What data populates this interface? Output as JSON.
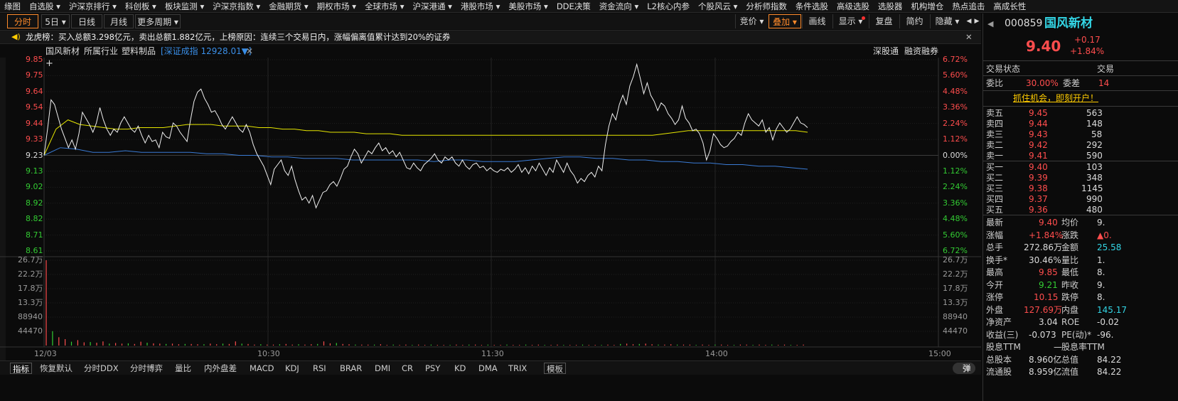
{
  "nav": {
    "items": [
      "缘图",
      "自选股 ▾",
      "沪深京排行 ▾",
      "科创板 ▾",
      "板块监测 ▾",
      "沪深京指数 ▾",
      "金融期货 ▾",
      "期权市场 ▾",
      "全球市场 ▾",
      "沪深港通 ▾",
      "港股市场 ▾",
      "美股市场 ▾",
      "DDE决策",
      "资金流向 ▾",
      "L2核心内参",
      "个股风云 ▾",
      "分析师指数",
      "条件选股",
      "高级选股",
      "选股器",
      "机构增仓",
      "热点追击",
      "高成长性"
    ]
  },
  "periods": {
    "intraday": "分时",
    "five_day": "5日 ▾",
    "daily": "日线",
    "monthly": "月线",
    "more": "更多周期 ▾"
  },
  "tools": {
    "bid": "竞价 ▾",
    "overlay": "叠加 ▾",
    "draw": "画线",
    "display": "显示 ▾",
    "replay": "复盘",
    "simple": "简约",
    "hide": "隐藏 ▾",
    "prev": "◀",
    "next": "▶",
    "close": "✕"
  },
  "banner": {
    "icon": "speaker-icon",
    "text": "龙虎榜：买入总额3.298亿元，卖出总额1.882亿元，上榜原因：连续三个交易日内，涨幅偏离值累计达到20%的证券",
    "close": "✕"
  },
  "chart_header": {
    "stock": "国风新材",
    "industry_label": "所属行业",
    "industry": "塑料制品",
    "index": "[深证成指 12928.01▼]",
    "index_close": "✕",
    "shgt": "深股通",
    "margin": "融资融券"
  },
  "chart_data": {
    "type": "line",
    "title": "",
    "price_axis": [
      "9.85",
      "9.75",
      "9.64",
      "9.54",
      "9.44",
      "9.33",
      "9.23",
      "9.13",
      "9.02",
      "8.92",
      "8.82",
      "8.71",
      "8.61"
    ],
    "pct_axis": [
      "6.72%",
      "5.60%",
      "4.48%",
      "3.36%",
      "2.24%",
      "1.12%",
      "0.00%",
      "1.12%",
      "2.24%",
      "3.36%",
      "4.48%",
      "5.60%",
      "6.72%"
    ],
    "pre_close": 9.23,
    "ylim": [
      8.61,
      9.85
    ],
    "volume_axis": [
      "26.7万",
      "22.2万",
      "17.8万",
      "13.3万",
      "88940",
      "44470"
    ],
    "time_labels": [
      "12/03",
      "10:30",
      "11:30",
      "14:00",
      "15:00"
    ],
    "series": [
      {
        "name": "price",
        "color": "#f0f0f0",
        "values": [
          9.23,
          9.4,
          9.59,
          9.56,
          9.48,
          9.4,
          9.34,
          9.28,
          9.33,
          9.27,
          9.37,
          9.51,
          9.47,
          9.43,
          9.38,
          9.44,
          9.54,
          9.46,
          9.4,
          9.36,
          9.4,
          9.38,
          9.44,
          9.48,
          9.44,
          9.4,
          9.38,
          9.42,
          9.36,
          9.31,
          9.36,
          9.32,
          9.33,
          9.28,
          9.38,
          9.35,
          9.34,
          9.44,
          9.42,
          9.38,
          9.35,
          9.32,
          9.46,
          9.58,
          9.64,
          9.66,
          9.6,
          9.56,
          9.51,
          9.52,
          9.48,
          9.43,
          9.4,
          9.44,
          9.48,
          9.44,
          9.4,
          9.38,
          9.43,
          9.38,
          9.3,
          9.24,
          9.2,
          9.16,
          9.1,
          9.04,
          9.14,
          9.17,
          9.2,
          9.13,
          9.1,
          9.16,
          9.07,
          9.0,
          8.94,
          8.96,
          8.92,
          8.97,
          8.89,
          8.94,
          8.99,
          9.0,
          9.04,
          9.06,
          9.03,
          9.08,
          9.14,
          9.16,
          9.22,
          9.27,
          9.24,
          9.18,
          9.22,
          9.26,
          9.24,
          9.28,
          9.31,
          9.26,
          9.28,
          9.24,
          9.26,
          9.22,
          9.25,
          9.2,
          9.15,
          9.14,
          9.18,
          9.15,
          9.13,
          9.17,
          9.19,
          9.21,
          9.24,
          9.2,
          9.18,
          9.22,
          9.2,
          9.22,
          9.18,
          9.16,
          9.2,
          9.16,
          9.14,
          9.17,
          9.18,
          9.15,
          9.16,
          9.13,
          9.15,
          9.13,
          9.12,
          9.14,
          9.13,
          9.15,
          9.12,
          9.14,
          9.17,
          9.12,
          9.15,
          9.11,
          9.16,
          9.13,
          9.18,
          9.14,
          9.1,
          9.15,
          9.12,
          9.2,
          9.16,
          9.12,
          9.18,
          9.13,
          9.1,
          9.05,
          9.08,
          9.06,
          9.1,
          9.12,
          9.09,
          9.16,
          9.13,
          9.3,
          9.42,
          9.5,
          9.46,
          9.56,
          9.62,
          9.56,
          9.68,
          9.74,
          9.82,
          9.73,
          9.63,
          9.7,
          9.62,
          9.58,
          9.52,
          9.57,
          9.55,
          9.5,
          9.47,
          9.43,
          9.46,
          9.55,
          9.47,
          9.44,
          9.39,
          9.4,
          9.37,
          9.31,
          9.2,
          9.26,
          9.37,
          9.34,
          9.3,
          9.28,
          9.29,
          9.32,
          9.34,
          9.38,
          9.36,
          9.44,
          9.5,
          9.46,
          9.44,
          9.42,
          9.46,
          9.38,
          9.41,
          9.33,
          9.4,
          9.44,
          9.41,
          9.38,
          9.4,
          9.44,
          9.48,
          9.44,
          9.43,
          9.41
        ]
      },
      {
        "name": "avg",
        "color": "#e6e600",
        "values": [
          9.23,
          9.4,
          9.46,
          9.43,
          9.42,
          9.41,
          9.4,
          9.4,
          9.41,
          9.41,
          9.41,
          9.42,
          9.43,
          9.43,
          9.43,
          9.42,
          9.42,
          9.42,
          9.41,
          9.41,
          9.4,
          9.4,
          9.39,
          9.39,
          9.38,
          9.38,
          9.38,
          9.37,
          9.37,
          9.37,
          9.36,
          9.36,
          9.36,
          9.36,
          9.36,
          9.36,
          9.36,
          9.36,
          9.36,
          9.36,
          9.36,
          9.36,
          9.36,
          9.36,
          9.36,
          9.36,
          9.36,
          9.36,
          9.36,
          9.36,
          9.36,
          9.36,
          9.37,
          9.38,
          9.39,
          9.39,
          9.39,
          9.39,
          9.39,
          9.39,
          9.39,
          9.39,
          9.39,
          9.39,
          9.38
        ]
      },
      {
        "name": "index",
        "color": "#3a7bd5",
        "values": [
          9.23,
          9.28,
          9.27,
          9.25,
          9.25,
          9.26,
          9.25,
          9.25,
          9.25,
          9.25,
          9.24,
          9.24,
          9.23,
          9.23,
          9.22,
          9.22,
          9.21,
          9.21,
          9.21,
          9.2,
          9.2,
          9.2,
          9.2,
          9.2,
          9.19,
          9.2,
          9.2,
          9.19,
          9.19,
          9.19,
          9.2,
          9.21,
          9.22,
          9.22,
          9.21,
          9.21,
          9.2,
          9.2,
          9.19,
          9.19,
          9.18,
          9.18,
          9.17,
          9.17,
          9.16,
          9.16,
          9.15,
          9.14
        ]
      }
    ],
    "volume": [
      26.7,
      4.5,
      2.6,
      2.0,
      1.2,
      1.7,
      1.0,
      1.1,
      0.9,
      1.3,
      0.6,
      0.8,
      0.6,
      0.7,
      0.5,
      1.2,
      0.9,
      0.7,
      0.6,
      0.5,
      0.6,
      0.4,
      0.5,
      0.5,
      0.4,
      0.4,
      0.6,
      0.4,
      0.6,
      0.5,
      1.3,
      0.6,
      0.5,
      0.3,
      0.4,
      0.3,
      0.3,
      0.4,
      0.5,
      0.3,
      0.4,
      0.3,
      0.4,
      0.5,
      1.3,
      0.7,
      0.8,
      0.5,
      0.4,
      0.3,
      0.3,
      0.3,
      0.3,
      0.4,
      0.2,
      0.3,
      0.2,
      0.3,
      0.2,
      0.3,
      0.2,
      0.3,
      0.2,
      0.2,
      0.2,
      0.3,
      0.2,
      0.3,
      0.3,
      0.2,
      0.3,
      0.2,
      0.2,
      0.3,
      0.2,
      0.2,
      0.3,
      0.2,
      0.3,
      0.2,
      0.2,
      0.3,
      0.2,
      0.2,
      0.2,
      0.3,
      0.2,
      0.2,
      0.2,
      0.3,
      0.2,
      0.5,
      0.6,
      0.4,
      0.5,
      0.6,
      0.4,
      0.3,
      0.3,
      0.4,
      0.3,
      0.3,
      0.3,
      0.2,
      0.3,
      0.2,
      0.3,
      0.3,
      0.2,
      0.2,
      0.3,
      0.3,
      0.2,
      0.3,
      0.2,
      0.3,
      0.2,
      0.3,
      0.2,
      0.2,
      0.3
    ]
  },
  "indicators": {
    "items": [
      "指标",
      "恢复默认",
      "分时DDX",
      "分时博弈",
      "量比",
      "内外盘差",
      "MACD",
      "KDJ",
      "RSI",
      "BRAR",
      "DMI",
      "CR",
      "PSY",
      "KD",
      "DMA",
      "TRIX",
      "模板"
    ],
    "popup": "弹"
  },
  "quote": {
    "code": "000859",
    "name": "国风新材",
    "price": "9.40",
    "change": "+0.17",
    "change_pct": "+1.84%",
    "trade_status_label": "交易状态",
    "trade_label2": "交易",
    "weibi_label": "委比",
    "weibi": "30.00%",
    "weicha_label": "委差",
    "weicha": "14",
    "promo": "抓住机会，即刻开户！",
    "asks": [
      {
        "label": "卖五",
        "price": "9.45",
        "vol": "563"
      },
      {
        "label": "卖四",
        "price": "9.44",
        "vol": "148"
      },
      {
        "label": "卖三",
        "price": "9.43",
        "vol": "58"
      },
      {
        "label": "卖二",
        "price": "9.42",
        "vol": "292"
      },
      {
        "label": "卖一",
        "price": "9.41",
        "vol": "590"
      }
    ],
    "bids": [
      {
        "label": "买一",
        "price": "9.40",
        "vol": "103"
      },
      {
        "label": "买二",
        "price": "9.39",
        "vol": "348"
      },
      {
        "label": "买三",
        "price": "9.38",
        "vol": "1145"
      },
      {
        "label": "买四",
        "price": "9.37",
        "vol": "990"
      },
      {
        "label": "买五",
        "price": "9.36",
        "vol": "480"
      }
    ],
    "stats": [
      {
        "l1": "最新",
        "v1": "9.40",
        "c1": "red",
        "l2": "均价",
        "v2": "9."
      },
      {
        "l1": "涨幅",
        "v1": "+1.84%",
        "c1": "red",
        "l2": "涨跌",
        "v2": "▲0."
      },
      {
        "l1": "总手",
        "v1": "272.86万",
        "c1": "white",
        "l2": "金额",
        "v2": "25.58"
      },
      {
        "l1": "换手*",
        "v1": "30.46%",
        "c1": "white",
        "l2": "量比",
        "v2": "1."
      },
      {
        "l1": "最高",
        "v1": "9.85",
        "c1": "red",
        "l2": "最低",
        "v2": "8."
      },
      {
        "l1": "今开",
        "v1": "9.21",
        "c1": "green",
        "l2": "昨收",
        "v2": "9."
      },
      {
        "l1": "涨停",
        "v1": "10.15",
        "c1": "red",
        "l2": "跌停",
        "v2": "8."
      },
      {
        "l1": "外盘",
        "v1": "127.69万",
        "c1": "red",
        "l2": "内盘",
        "v2": "145.17"
      },
      {
        "l1": "净资产",
        "v1": "3.04",
        "c1": "white",
        "l2": "ROE",
        "v2": "-0.02"
      },
      {
        "l1": "收益(三)",
        "v1": "-0.073",
        "c1": "white",
        "l2": "PE(动)*",
        "v2": "-96."
      },
      {
        "l1": "股息TTM",
        "v1": "—",
        "c1": "white",
        "l2": "股息率TTM",
        "v2": ""
      },
      {
        "l1": "总股本",
        "v1": "8.960亿",
        "c1": "white",
        "l2": "总值",
        "v2": "84.22"
      },
      {
        "l1": "流通股",
        "v1": "8.959亿",
        "c1": "white",
        "l2": "流值",
        "v2": "84.22"
      }
    ]
  }
}
